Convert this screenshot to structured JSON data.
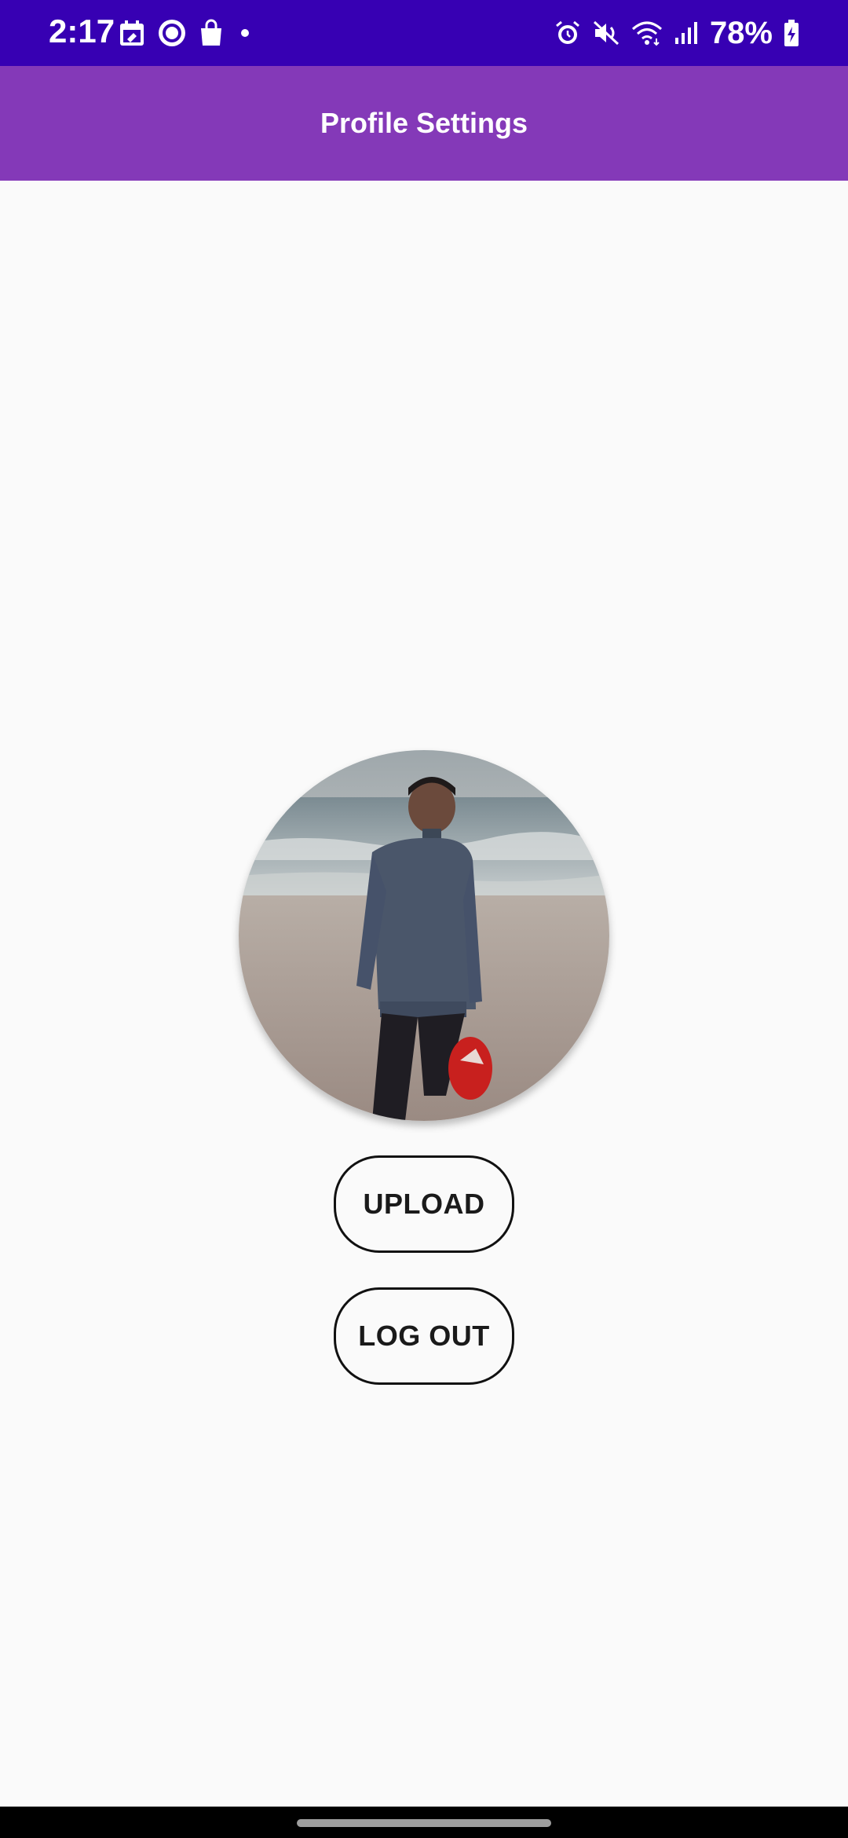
{
  "status_bar": {
    "time": "2:17",
    "battery_percent": "78%",
    "background_color": "#3700b3",
    "left_icons": [
      "calendar-icon",
      "circle-app-icon",
      "shopping-bag-icon",
      "notification-dot-icon"
    ],
    "right_icons": [
      "alarm-icon",
      "vibrate-mute-icon",
      "wifi-icon",
      "signal-icon",
      "battery-charging-icon"
    ]
  },
  "app_bar": {
    "title": "Profile Settings",
    "background_color": "#8439b8"
  },
  "profile": {
    "avatar_description_icon": "profile-photo"
  },
  "actions": {
    "upload_label": "UPLOAD",
    "logout_label": "LOG OUT"
  }
}
